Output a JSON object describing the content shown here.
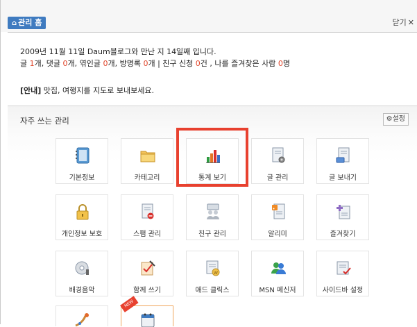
{
  "header": {
    "home_label": "관리 홈",
    "close_label": "닫기",
    "close_glyph": "✕"
  },
  "summary": {
    "line1": "2009년 11월 11일 Daum블로그와 만난 지 14일째 입니다.",
    "posts_label": "글 ",
    "posts_count": "1",
    "posts_unit": "개, 댓글 ",
    "comments_count": "0",
    "comments_unit": "개, 엮인글 ",
    "trackbacks_count": "0",
    "trackbacks_unit": "개, 방명록 ",
    "guestbook_count": "0",
    "guestbook_unit": "개 | 친구 신청 ",
    "friend_req_count": "0",
    "friend_req_unit": "건 , 나를 즐겨찾은 사람 ",
    "favorited_count": "0",
    "favorited_unit": "명"
  },
  "notice": {
    "tag": "[안내]",
    "text": " 맛집, 여행지를 지도로 보내보세요."
  },
  "panel": {
    "title": "자주 쓰는 관리",
    "settings_label": "설정"
  },
  "tiles": [
    {
      "label": "기본정보",
      "icon": "notebook-icon"
    },
    {
      "label": "카테고리",
      "icon": "folder-icon"
    },
    {
      "label": "통계 보기",
      "icon": "bar-chart-icon"
    },
    {
      "label": "글 관리",
      "icon": "document-gear-icon"
    },
    {
      "label": "글 보내기",
      "icon": "document-send-icon"
    },
    {
      "label": "개인정보 보호",
      "icon": "lock-icon"
    },
    {
      "label": "스팸 관리",
      "icon": "spam-document-icon"
    },
    {
      "label": "친구 관리",
      "icon": "friends-icon"
    },
    {
      "label": "알리미",
      "icon": "rss-document-icon"
    },
    {
      "label": "즐겨찾기",
      "icon": "favorites-icon"
    },
    {
      "label": "배경음악",
      "icon": "music-disc-icon"
    },
    {
      "label": "함께 쓰기",
      "icon": "pencil-check-icon"
    },
    {
      "label": "애드 클릭스",
      "icon": "ad-coin-icon"
    },
    {
      "label": "MSN 메신저",
      "icon": "messenger-icon"
    },
    {
      "label": "사이드바 설정",
      "icon": "sidebar-check-icon"
    }
  ],
  "colors": {
    "accent": "#3f7bc0",
    "highlight": "#e8412f",
    "count": "#e0452a"
  }
}
